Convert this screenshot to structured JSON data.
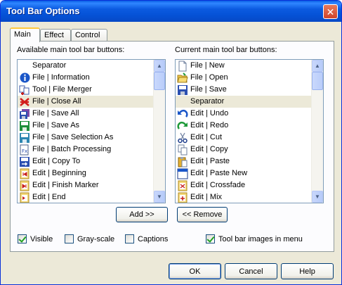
{
  "window": {
    "title": "Tool Bar Options"
  },
  "tabs": [
    {
      "label": "Main",
      "active": true
    },
    {
      "label": "Effect",
      "active": false
    },
    {
      "label": "Control",
      "active": false
    }
  ],
  "available": {
    "label": "Available main tool bar buttons:",
    "items": [
      {
        "label": "Separator",
        "icon": "none"
      },
      {
        "label": "File | Information",
        "icon": "info-icon"
      },
      {
        "label": "Tool | File Merger",
        "icon": "file-merger-icon"
      },
      {
        "label": "File | Close All",
        "icon": "close-all-icon",
        "selected": true
      },
      {
        "label": "File | Save All",
        "icon": "save-all-icon"
      },
      {
        "label": "File | Save As",
        "icon": "save-as-icon"
      },
      {
        "label": "File | Save Selection As",
        "icon": "save-selection-icon"
      },
      {
        "label": "File | Batch Processing",
        "icon": "batch-processing-icon"
      },
      {
        "label": "Edit | Copy To",
        "icon": "copy-to-icon"
      },
      {
        "label": "Edit | Beginning",
        "icon": "beginning-icon"
      },
      {
        "label": "Edit | Finish Marker",
        "icon": "finish-marker-icon"
      },
      {
        "label": "Edit | End",
        "icon": "end-icon"
      }
    ]
  },
  "current": {
    "label": "Current main tool bar buttons:",
    "items": [
      {
        "label": "File | New",
        "icon": "new-file-icon"
      },
      {
        "label": "File | Open",
        "icon": "open-folder-icon"
      },
      {
        "label": "File | Save",
        "icon": "save-icon"
      },
      {
        "label": "Separator",
        "icon": "none",
        "selected": true
      },
      {
        "label": "Edit | Undo",
        "icon": "undo-icon"
      },
      {
        "label": "Edit | Redo",
        "icon": "redo-icon"
      },
      {
        "label": "Edit | Cut",
        "icon": "cut-icon"
      },
      {
        "label": "Edit | Copy",
        "icon": "copy-icon"
      },
      {
        "label": "Edit | Paste",
        "icon": "paste-icon"
      },
      {
        "label": "Edit | Paste New",
        "icon": "paste-new-icon"
      },
      {
        "label": "Edit | Crossfade",
        "icon": "crossfade-icon"
      },
      {
        "label": "Edit | Mix",
        "icon": "mix-icon"
      }
    ]
  },
  "buttons": {
    "add": "Add >>",
    "remove": "<< Remove",
    "ok": "OK",
    "cancel": "Cancel",
    "help": "Help"
  },
  "options": {
    "visible": {
      "label": "Visible",
      "checked": true
    },
    "grayscale": {
      "label": "Gray-scale",
      "checked": false
    },
    "captions": {
      "label": "Captions",
      "checked": false
    },
    "images_in_menu": {
      "label": "Tool bar images in menu",
      "checked": true
    }
  },
  "colors": {
    "titlebar": "#0552d6",
    "dialog_bg": "#ece9d8",
    "list_border": "#7f9db9",
    "selection": "#ece9d8"
  }
}
